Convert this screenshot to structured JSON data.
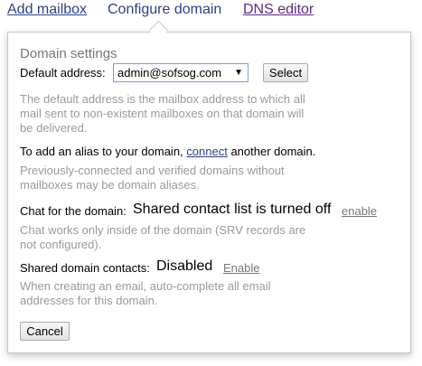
{
  "tabs": {
    "add_mailbox": "Add mailbox",
    "configure_domain": "Configure domain",
    "dns_editor": "DNS editor"
  },
  "popup": {
    "heading": "Domain settings",
    "default_address": {
      "label": "Default address:",
      "selected_value": "admin@sofsog.com",
      "select_button": "Select",
      "description": "The default address is the mailbox address to which all mail sent to non-existent mailboxes on that domain will be delivered."
    },
    "alias": {
      "text_before": "To add an alias to your domain, ",
      "link": "connect",
      "text_after": " another domain.",
      "description": "Previously-connected and verified domains without mailboxes may be domain aliases."
    },
    "chat": {
      "label": "Chat for the domain:",
      "status": "Shared contact list is turned off",
      "action_link": "enable",
      "description": "Chat works only inside of the domain (SRV records are not configured)."
    },
    "shared_contacts": {
      "label": "Shared domain contacts:",
      "status": "Disabled",
      "action_link": "Enable",
      "description": "When creating an email, auto-complete all email addresses for this domain."
    },
    "cancel_button": "Cancel"
  },
  "colors": {
    "link_blue": "#2b3f8e",
    "visited_purple": "#5c2a86",
    "hint_gray": "#999999"
  }
}
